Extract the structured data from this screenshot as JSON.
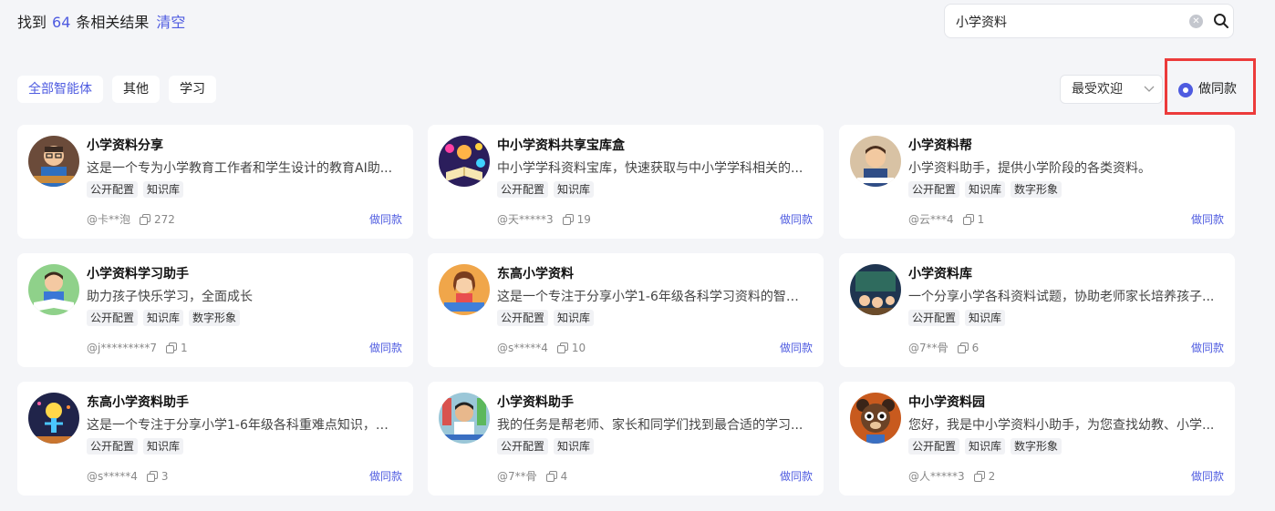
{
  "results": {
    "prefix": "找到",
    "count": "64",
    "suffix": "条相关结果",
    "clear_label": "清空"
  },
  "search": {
    "value": "小学资料"
  },
  "tabs": [
    {
      "label": "全部智能体",
      "active": true
    },
    {
      "label": "其他",
      "active": false
    },
    {
      "label": "学习",
      "active": false
    }
  ],
  "sort": {
    "selected": "最受欢迎"
  },
  "make_same_toggle": {
    "label": "做同款",
    "checked": true
  },
  "colors": {
    "accent": "#4e5be0",
    "highlight_border": "#ec3b3b"
  },
  "cards": [
    {
      "title": "小学资料分享",
      "desc": "这是一个专为小学教育工作者和学生设计的教育AI助...",
      "tags": [
        "公开配置",
        "知识库"
      ],
      "author": "@卡**泡",
      "uses": "272",
      "action": "做同款",
      "avatar": "teacher-avatar"
    },
    {
      "title": "中小学资料共享宝库盒",
      "desc": "中小学学科资料宝库，快速获取与中小学学科相关的...",
      "tags": [
        "公开配置",
        "知识库"
      ],
      "author": "@天*****3",
      "uses": "19",
      "action": "做同款",
      "avatar": "treasure-book-avatar"
    },
    {
      "title": "小学资料帮",
      "desc": "小学资料助手，提供小学阶段的各类资料。",
      "tags": [
        "公开配置",
        "知识库",
        "数字形象"
      ],
      "author": "@云***4",
      "uses": "1",
      "action": "做同款",
      "avatar": "boy-student-avatar"
    },
    {
      "title": "小学资料学习助手",
      "desc": "助力孩子快乐学习，全面成长",
      "tags": [
        "公开配置",
        "知识库",
        "数字形象"
      ],
      "author": "@j*********7",
      "uses": "1",
      "action": "做同款",
      "avatar": "reading-boy-avatar"
    },
    {
      "title": "东高小学资料",
      "desc": "这是一个专注于分享小学1-6年级各科学习资料的智能...",
      "tags": [
        "公开配置",
        "知识库"
      ],
      "author": "@s*****4",
      "uses": "10",
      "action": "做同款",
      "avatar": "girl-books-avatar"
    },
    {
      "title": "小学资料库",
      "desc": "一个分享小学各科资料试题，协助老师家长培养孩子...",
      "tags": [
        "公开配置",
        "知识库"
      ],
      "author": "@7**骨",
      "uses": "6",
      "action": "做同款",
      "avatar": "classroom-avatar"
    },
    {
      "title": "东高小学资料助手",
      "desc": "这是一个专注于分享小学1-6年级各科重难点知识，各...",
      "tags": [
        "公开配置",
        "知识库"
      ],
      "author": "@s*****4",
      "uses": "3",
      "action": "做同款",
      "avatar": "lightbulb-figure-avatar"
    },
    {
      "title": "小学资料助手",
      "desc": "我的任务是帮老师、家长和同学们找到最合适的学习...",
      "tags": [
        "公开配置",
        "知识库"
      ],
      "author": "@7**骨",
      "uses": "4",
      "action": "做同款",
      "avatar": "studying-boy-avatar"
    },
    {
      "title": "中小学资料园",
      "desc": "您好，我是中小学资料小助手，为您查找幼教、小学...",
      "tags": [
        "公开配置",
        "知识库",
        "数字形象"
      ],
      "author": "@人*****3",
      "uses": "2",
      "action": "做同款",
      "avatar": "panda-mascot-avatar"
    }
  ]
}
